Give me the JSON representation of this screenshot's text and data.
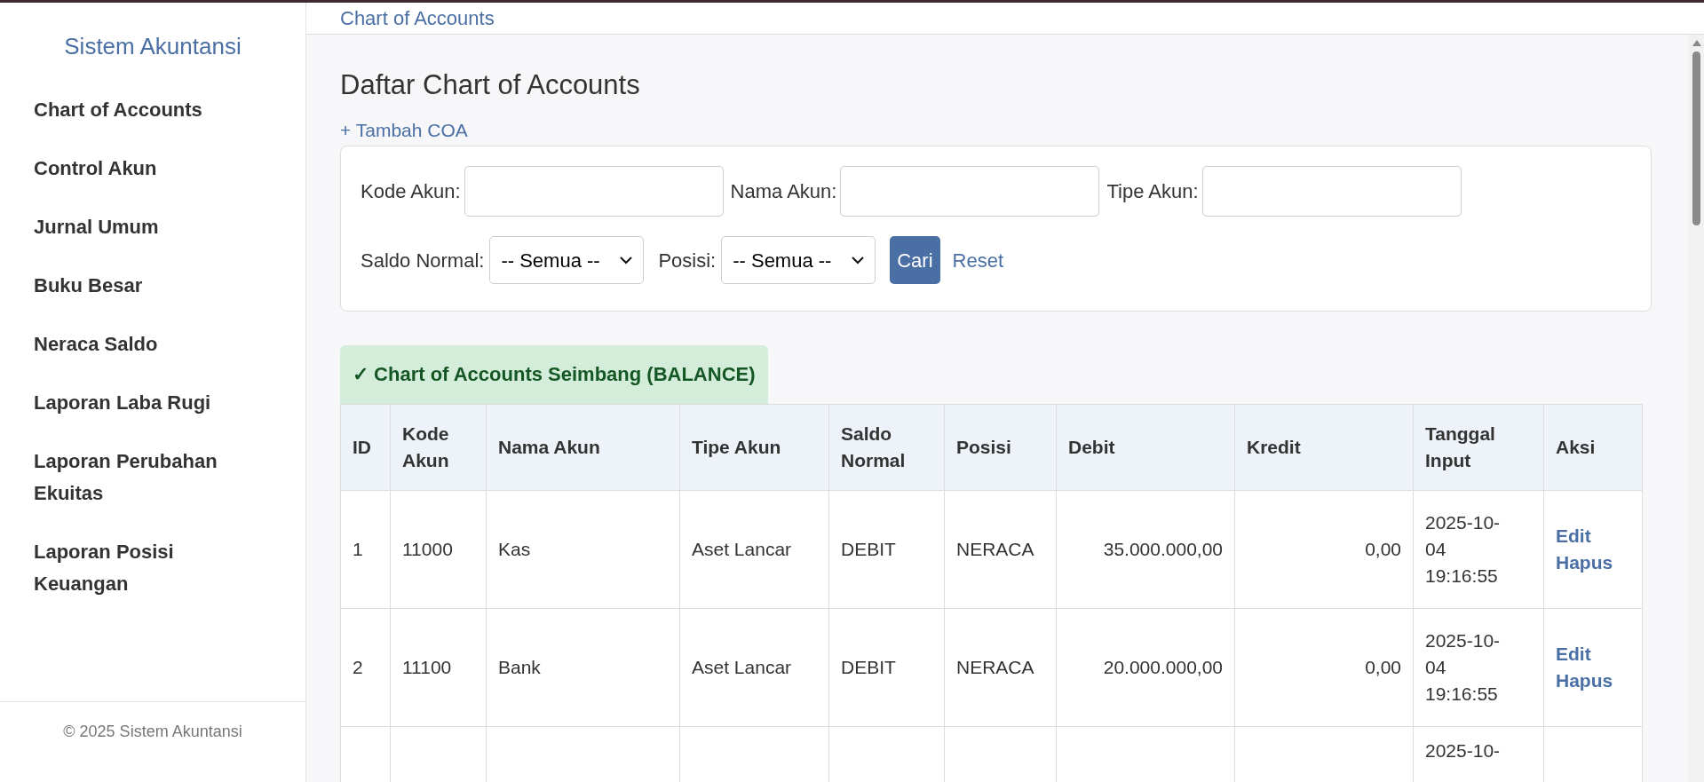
{
  "sidebar": {
    "brand": "Sistem Akuntansi",
    "items": [
      {
        "label": "Chart of Accounts"
      },
      {
        "label": "Control Akun"
      },
      {
        "label": "Jurnal Umum"
      },
      {
        "label": "Buku Besar"
      },
      {
        "label": "Neraca Saldo"
      },
      {
        "label": "Laporan Laba Rugi"
      },
      {
        "label": "Laporan Perubahan Ekuitas"
      },
      {
        "label": "Laporan Posisi Keuangan"
      }
    ],
    "footer": "© 2025 Sistem Akuntansi"
  },
  "topbar": {
    "breadcrumb": "Chart of Accounts"
  },
  "page": {
    "title": "Daftar Chart of Accounts",
    "add_link": "+ Tambah COA"
  },
  "filters": {
    "fields": [
      {
        "label": "Kode Akun:"
      },
      {
        "label": "Nama Akun:"
      },
      {
        "label": "Tipe Akun:"
      }
    ],
    "selects": [
      {
        "label": "Saldo Normal:",
        "value": "-- Semua --"
      },
      {
        "label": "Posisi:",
        "value": "-- Semua --"
      }
    ],
    "search_button": "Cari",
    "reset_link": "Reset"
  },
  "alert": {
    "text": "✓ Chart of Accounts Seimbang (BALANCE)"
  },
  "table": {
    "columns": [
      "ID",
      "Kode Akun",
      "Nama Akun",
      "Tipe Akun",
      "Saldo Normal",
      "Posisi",
      "Debit",
      "Kredit",
      "Tanggal Input",
      "Aksi"
    ],
    "rows": [
      {
        "id": "1",
        "kode": "11000",
        "nama": "Kas",
        "tipe": "Aset Lancar",
        "saldo": "DEBIT",
        "posisi": "NERACA",
        "debit": "35.000.000,00",
        "kredit": "0,00",
        "tanggal": "2025-10-04 19:16:55",
        "actions": [
          "Edit",
          "Hapus"
        ]
      },
      {
        "id": "2",
        "kode": "11100",
        "nama": "Bank",
        "tipe": "Aset Lancar",
        "saldo": "DEBIT",
        "posisi": "NERACA",
        "debit": "20.000.000,00",
        "kredit": "0,00",
        "tanggal": "2025-10-04 19:16:55",
        "actions": [
          "Edit",
          "Hapus"
        ]
      },
      {
        "tanggal": "2025-10-"
      }
    ]
  }
}
